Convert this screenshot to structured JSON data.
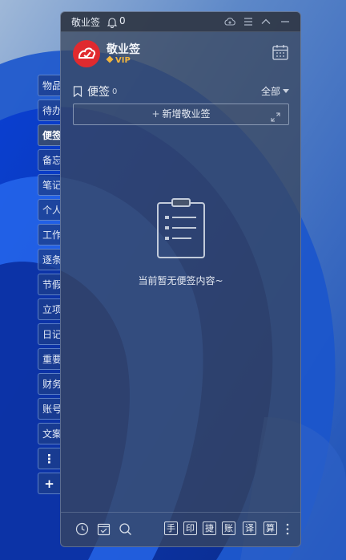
{
  "window": {
    "title": "敬业签",
    "notification_count": "0"
  },
  "account": {
    "name": "敬业签",
    "badge": "VIP"
  },
  "section": {
    "title": "便签",
    "count": "0",
    "filter": "全部"
  },
  "new_note": {
    "label": "新增敬业签"
  },
  "empty_state": {
    "message": "当前暂无便签内容~"
  },
  "side_tabs": [
    {
      "label": "物品",
      "active": false
    },
    {
      "label": "待办",
      "active": false
    },
    {
      "label": "便签",
      "active": true
    },
    {
      "label": "备忘",
      "active": false
    },
    {
      "label": "笔记",
      "active": false
    },
    {
      "label": "个人",
      "active": false
    },
    {
      "label": "工作",
      "active": false
    },
    {
      "label": "逐条",
      "active": false
    },
    {
      "label": "节假",
      "active": false
    },
    {
      "label": "立项",
      "active": false
    },
    {
      "label": "日记",
      "active": false
    },
    {
      "label": "重要",
      "active": false
    },
    {
      "label": "财务",
      "active": false
    },
    {
      "label": "账号",
      "active": false
    },
    {
      "label": "文案",
      "active": false
    }
  ],
  "side_more": "⋮",
  "side_add": "+",
  "bottom_tools": [
    {
      "label": "手"
    },
    {
      "label": "印"
    },
    {
      "label": "捷"
    },
    {
      "label": "账"
    },
    {
      "label": "译"
    },
    {
      "label": "算"
    }
  ],
  "icons": {
    "bell": "bell-icon",
    "cloud": "cloud-sync-icon",
    "menu": "menu-icon",
    "collapse": "chevron-up-icon",
    "minimize": "minimize-icon",
    "calendar": "calendar-icon",
    "bookmark": "bookmark-icon",
    "expand": "expand-icon",
    "clipboard": "clipboard-empty-icon",
    "clock": "clock-icon",
    "checkbox": "checkbox-calendar-icon",
    "search": "search-icon",
    "more": "more-vertical-icon"
  },
  "colors": {
    "accent_red": "#e02a2f",
    "vip_gold": "#f1b53e",
    "panel": "#3a465c"
  }
}
